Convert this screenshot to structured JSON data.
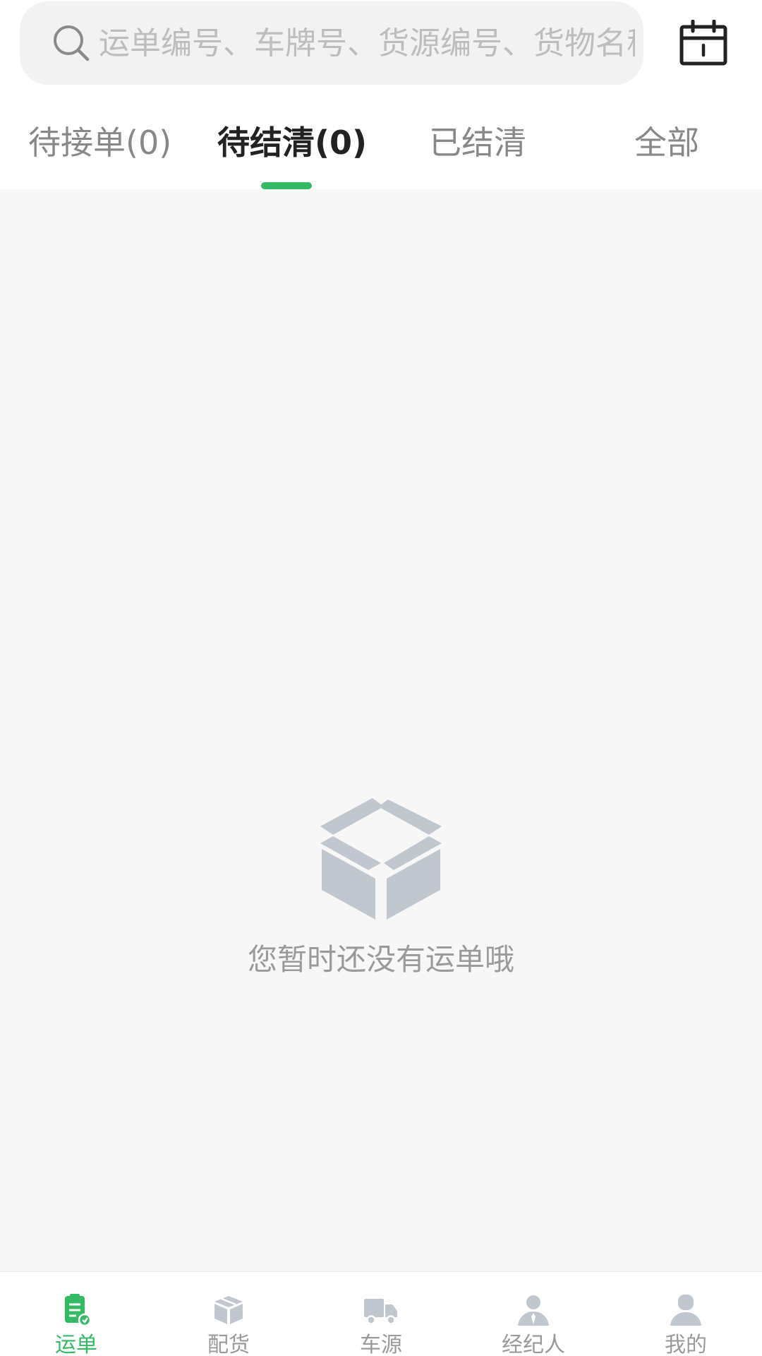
{
  "search": {
    "placeholder": "运单编号、车牌号、货源编号、货物名称",
    "value": ""
  },
  "tabs": [
    {
      "label": "待接单(0)",
      "active": false
    },
    {
      "label": "待结清(0)",
      "active": true
    },
    {
      "label": "已结清",
      "active": false
    },
    {
      "label": "全部",
      "active": false
    }
  ],
  "empty_state": {
    "icon": "open-box-icon",
    "message": "您暂时还没有运单哦"
  },
  "bottom_nav": [
    {
      "label": "运单",
      "icon": "waybill-icon",
      "active": true
    },
    {
      "label": "配货",
      "icon": "package-icon",
      "active": false
    },
    {
      "label": "车源",
      "icon": "truck-icon",
      "active": false
    },
    {
      "label": "经纪人",
      "icon": "agent-icon",
      "active": false
    },
    {
      "label": "我的",
      "icon": "user-icon",
      "active": false
    }
  ],
  "colors": {
    "accent": "#34b964",
    "inactive": "#9a9a9a",
    "background": "#f7f7f7",
    "icon_gray": "#c0c7cf"
  }
}
